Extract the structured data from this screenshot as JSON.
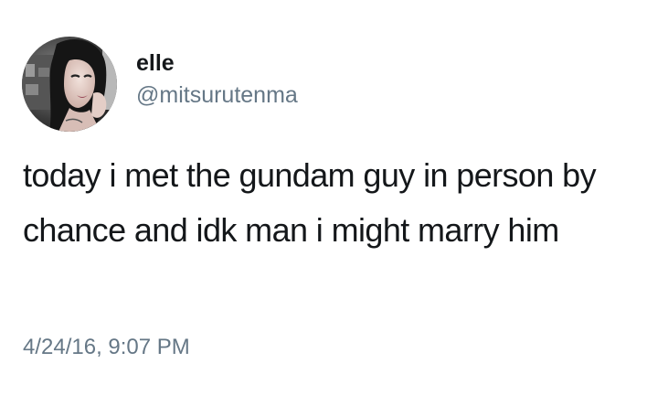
{
  "tweet": {
    "author": {
      "display_name": "elle",
      "handle": "@mitsurutenma",
      "avatar_icon": "profile-photo"
    },
    "text": "today i met the gundam guy in person by chance and idk man i might marry him",
    "timestamp": "4/24/16, 9:07 PM"
  },
  "colors": {
    "text_primary": "#14171a",
    "text_secondary": "#657786",
    "background": "#ffffff"
  }
}
